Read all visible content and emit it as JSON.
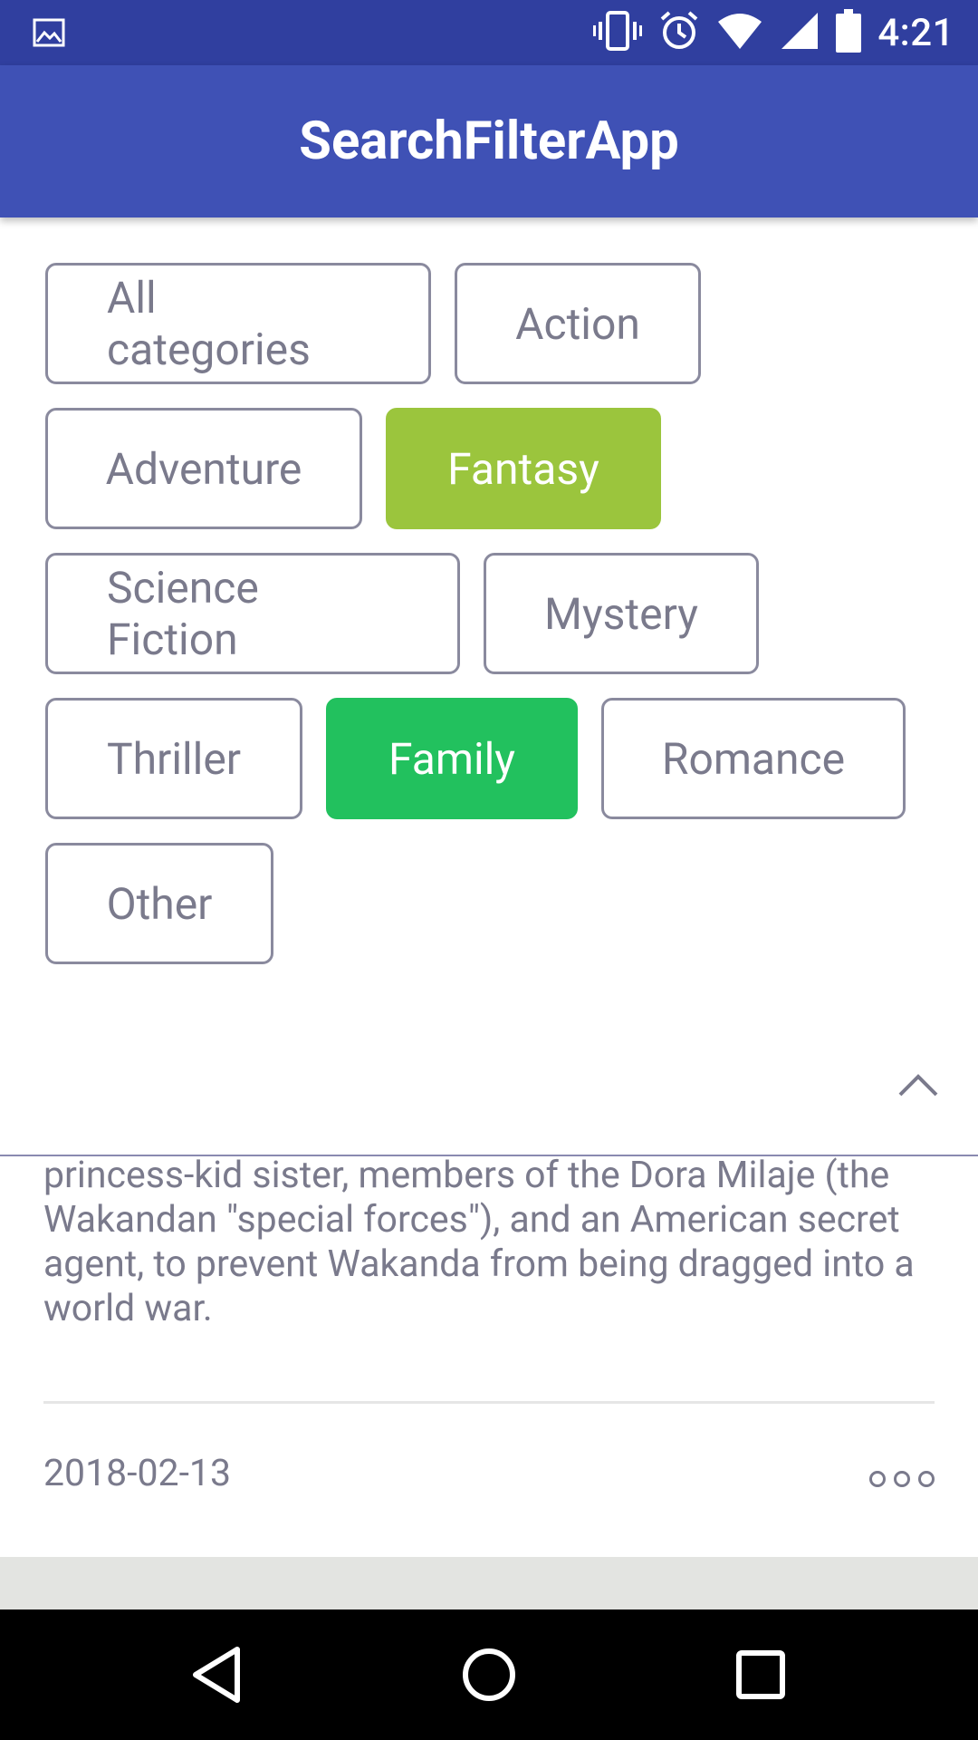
{
  "status_bar": {
    "time": "4:21",
    "icons": [
      "image-icon",
      "vibrate-icon",
      "alarm-icon",
      "wifi-icon",
      "cellular-icon",
      "battery-icon"
    ]
  },
  "app_bar": {
    "title": "SearchFilterApp"
  },
  "categories": {
    "all": "All categories",
    "action": "Action",
    "adventure": "Adventure",
    "fantasy": "Fantasy",
    "science_fiction": "Science Fiction",
    "mystery": "Mystery",
    "thriller": "Thriller",
    "family": "Family",
    "romance": "Romance",
    "other": "Other",
    "selected": [
      "Fantasy",
      "Family"
    ],
    "colors": {
      "fantasy": "#9BC53D",
      "family": "#22C15E"
    }
  },
  "card": {
    "description": "to join with girlfriend Nakia, the queen-mother, his princess-kid sister, members of the Dora Milaje (the Wakandan \"special forces\"), and an American secret agent, to prevent Wakanda from being dragged into a world war.",
    "date": "2018-02-13"
  },
  "theme": {
    "status_bar": "#303F9F",
    "app_bar": "#3F51B5",
    "chip_text": "#7a7a8c"
  },
  "nav_bar": {
    "icons": [
      "back-icon",
      "home-icon",
      "recents-icon"
    ]
  }
}
